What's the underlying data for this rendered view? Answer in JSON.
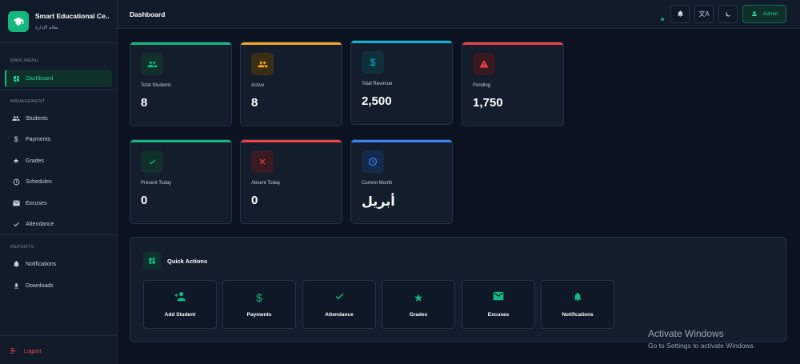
{
  "brand": {
    "title": "Smart Educational Ce...",
    "subtitle": "نظام الإدارة"
  },
  "sidebar": {
    "sections": {
      "main": "MAIN MENU",
      "management": "MANAGEMENT",
      "reports": "REPORTS"
    },
    "items": [
      {
        "label": "Dashboard",
        "icon": "dashboard-icon"
      },
      {
        "label": "Students",
        "icon": "people-icon"
      },
      {
        "label": "Payments",
        "icon": "dollar-icon"
      },
      {
        "label": "Grades",
        "icon": "star-icon"
      },
      {
        "label": "Schedules",
        "icon": "clock-icon"
      },
      {
        "label": "Excuses",
        "icon": "mail-icon"
      },
      {
        "label": "Attendance",
        "icon": "check-icon"
      },
      {
        "label": "Notifications",
        "icon": "bell-icon"
      },
      {
        "label": "Downloads",
        "icon": "download-icon"
      }
    ],
    "logout": "Logout"
  },
  "header": {
    "title": "Dashboard",
    "admin_label": "Admin"
  },
  "stats": [
    {
      "label": "Total Students",
      "value": "8",
      "color": "#14b87d",
      "icon": "people-icon"
    },
    {
      "label": "Active",
      "value": "8",
      "color": "#f5a524",
      "icon": "people-icon"
    },
    {
      "label": "Total Revenue",
      "value": "2,500",
      "color": "#06b6d4",
      "icon": "dollar-icon"
    },
    {
      "label": "Pending",
      "value": "1,750",
      "color": "#ef4444",
      "icon": "warning-icon"
    },
    {
      "label": "Present Today",
      "value": "0",
      "color": "#14b87d",
      "icon": "check-icon"
    },
    {
      "label": "Absent Today",
      "value": "0",
      "color": "#ef4444",
      "icon": "close-icon"
    },
    {
      "label": "Current Month",
      "value": "أبريل",
      "color": "#3b82f6",
      "icon": "clock-icon"
    }
  ],
  "quick_actions": {
    "title": "Quick Actions",
    "items": [
      {
        "label": "Add Student",
        "icon": "add-person-icon"
      },
      {
        "label": "Payments",
        "icon": "dollar-icon"
      },
      {
        "label": "Attendance",
        "icon": "check-icon"
      },
      {
        "label": "Grades",
        "icon": "star-icon"
      },
      {
        "label": "Excuses",
        "icon": "mail-icon"
      },
      {
        "label": "Notifications",
        "icon": "bell-icon"
      }
    ]
  },
  "watermark": {
    "line1": "Activate Windows",
    "line2": "Go to Settings to activate Windows."
  }
}
